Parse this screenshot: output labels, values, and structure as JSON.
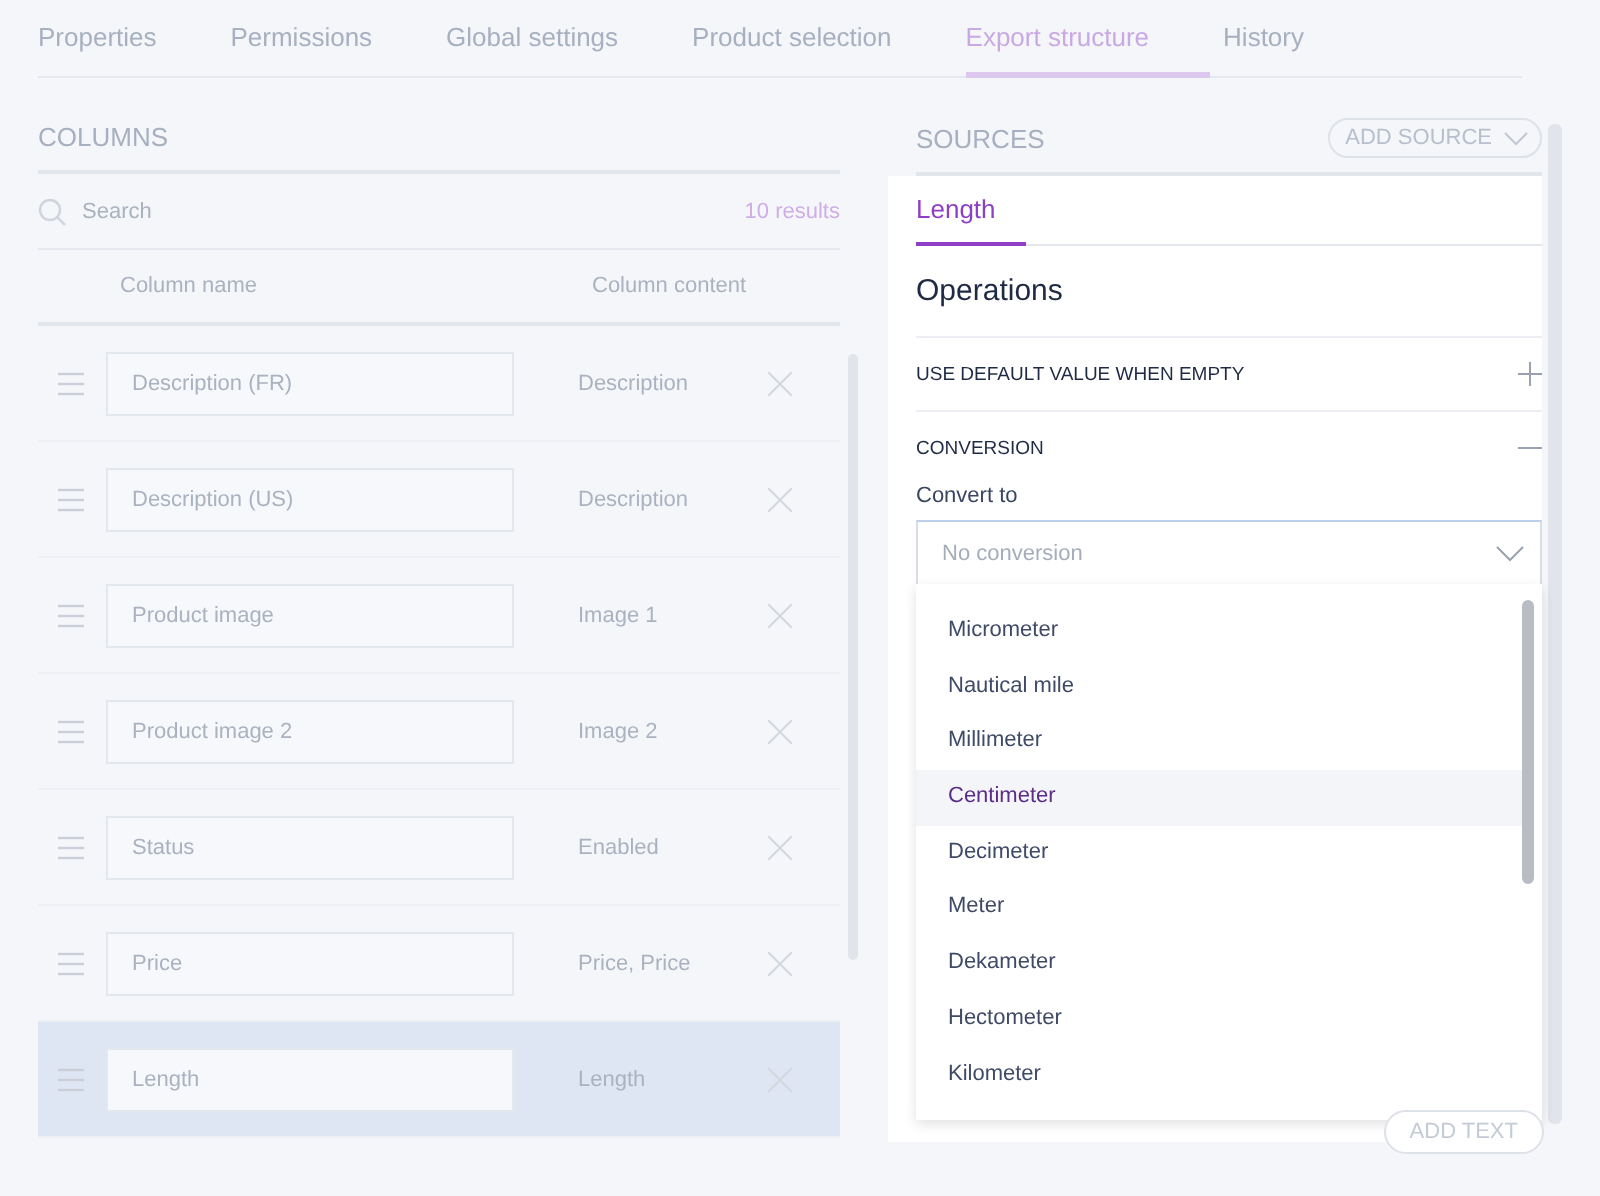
{
  "tabs": [
    {
      "label": "Properties",
      "selected": false
    },
    {
      "label": "Permissions",
      "selected": false
    },
    {
      "label": "Global settings",
      "selected": false
    },
    {
      "label": "Product selection",
      "selected": false
    },
    {
      "label": "Export structure",
      "selected": true
    },
    {
      "label": "History",
      "selected": false
    }
  ],
  "columns": {
    "title": "COLUMNS",
    "search": {
      "placeholder": "Search"
    },
    "results": "10 results",
    "headers": [
      "Column name",
      "Column content"
    ],
    "rows": [
      {
        "name": "Description (FR)",
        "content": "Description",
        "selected": false
      },
      {
        "name": "Description (US)",
        "content": "Description",
        "selected": false
      },
      {
        "name": "Product image",
        "content": "Image 1",
        "selected": false
      },
      {
        "name": "Product image 2",
        "content": "Image 2",
        "selected": false
      },
      {
        "name": "Status",
        "content": "Enabled",
        "selected": false
      },
      {
        "name": "Price",
        "content": "Price, Price",
        "selected": false
      },
      {
        "name": "Length",
        "content": "Length",
        "selected": true
      }
    ]
  },
  "sources": {
    "title": "SOURCES",
    "add_button": "ADD SOURCE",
    "tabs": [
      {
        "label": "Length",
        "selected": true
      }
    ],
    "operations_title": "Operations",
    "operations": [
      {
        "label": "USE DEFAULT VALUE WHEN EMPTY",
        "expanded": false
      },
      {
        "label": "CONVERSION",
        "expanded": true,
        "field_label": "Convert to",
        "select": {
          "value": "No conversion",
          "options": [
            {
              "label": "Micrometer",
              "selected": false
            },
            {
              "label": "Nautical mile",
              "selected": false
            },
            {
              "label": "Millimeter",
              "selected": false
            },
            {
              "label": "Centimeter",
              "selected": true
            },
            {
              "label": "Decimeter",
              "selected": false
            },
            {
              "label": "Meter",
              "selected": false
            },
            {
              "label": "Dekameter",
              "selected": false
            },
            {
              "label": "Hectometer",
              "selected": false
            },
            {
              "label": "Kilometer",
              "selected": false
            }
          ]
        }
      }
    ],
    "add_text_button": "ADD TEXT"
  }
}
